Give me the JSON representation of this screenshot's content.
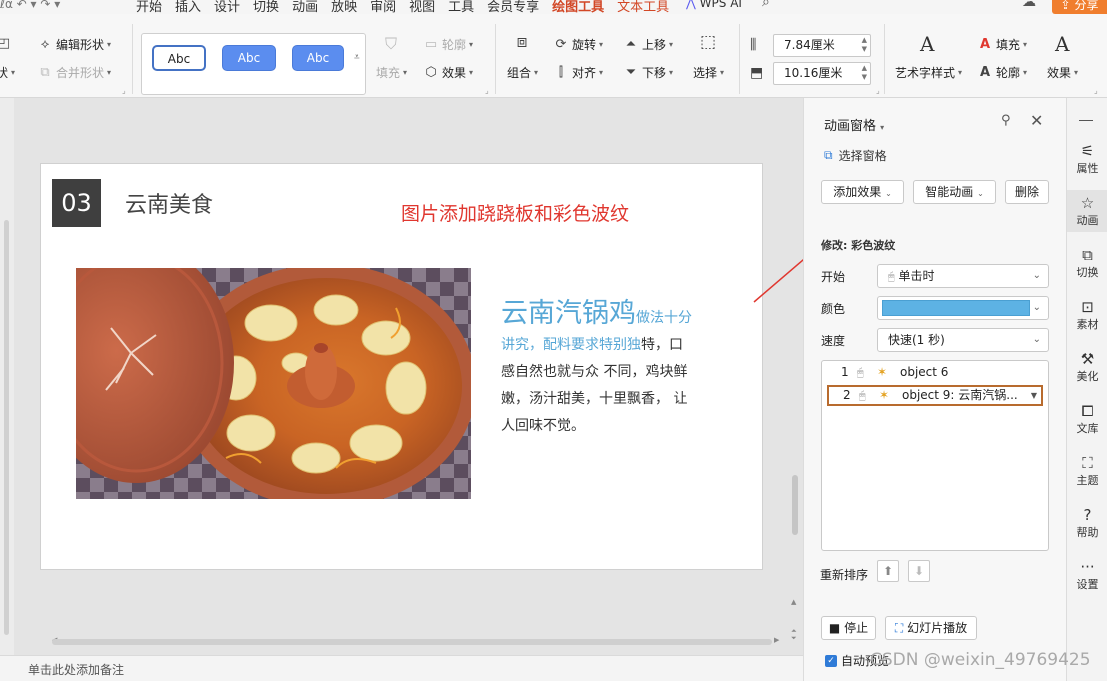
{
  "menu": {
    "quick_access": "ℓα ↶ ▾ ↷ ▾",
    "items": [
      "开始",
      "插入",
      "设计",
      "切换",
      "动画",
      "放映",
      "审阅",
      "视图",
      "工具",
      "会员专享"
    ],
    "active_tab": "绘图工具",
    "text_tab": "文本工具",
    "wps_ai": "WPS AI",
    "share": "分享"
  },
  "ribbon": {
    "edit_shape": "编辑形状",
    "shape": "状",
    "merge_shape": "合并形状",
    "style_gallery": [
      "Abc",
      "Abc",
      "Abc"
    ],
    "fill": "填充",
    "outline": "轮廓",
    "effect": "效果",
    "group": "组合",
    "rotate": "旋转",
    "align": "对齐",
    "move_up": "上移",
    "move_down": "下移",
    "select": "选择",
    "height": "7.84厘米",
    "width": "10.16厘米",
    "art_text_style": "艺术字样式",
    "text_fill": "填充",
    "text_outline": "轮廓",
    "text_effect": "效果"
  },
  "slide": {
    "number": "03",
    "title": "云南美食",
    "annotation": "图片添加跷跷板和彩色波纹",
    "dish": "云南汽锅鸡",
    "desc_blue_1": "做法十分",
    "desc_blue_2": "讲究，配料要求特别独",
    "desc_rest_1": "特，口",
    "desc_rest_2": "感自然也就与众 不同，鸡块鲜",
    "desc_rest_3": "嫩，汤汁甜美，十里飘香， 让",
    "desc_rest_4": "人回味不觉。"
  },
  "notes_placeholder": "单击此处添加备注",
  "pane": {
    "title": "动画窗格",
    "select_pane": "选择窗格",
    "add_effect": "添加效果",
    "smart_anim": "智能动画",
    "delete": "删除",
    "modify": "修改: 彩色波纹",
    "start_label": "开始",
    "start_value": "单击时",
    "color_label": "颜色",
    "color_value": "#5db2e4",
    "speed_label": "速度",
    "speed_value": "快速(1 秒)",
    "items": [
      {
        "num": "1",
        "label": "object 6"
      },
      {
        "num": "2",
        "label": "object 9: 云南汽锅..."
      }
    ],
    "reorder": "重新排序",
    "stop": "停止",
    "slideshow": "幻灯片播放",
    "auto_preview": "自动预览"
  },
  "sidebar": [
    {
      "label": "属性",
      "icon": "properties-icon"
    },
    {
      "label": "动画",
      "icon": "star-icon"
    },
    {
      "label": "切换",
      "icon": "transition-icon"
    },
    {
      "label": "素材",
      "icon": "material-icon"
    },
    {
      "label": "美化",
      "icon": "magic-icon"
    },
    {
      "label": "文库",
      "icon": "library-icon"
    },
    {
      "label": "主题",
      "icon": "theme-icon"
    },
    {
      "label": "帮助",
      "icon": "help-icon"
    },
    {
      "label": "设置",
      "icon": "settings-icon"
    }
  ],
  "watermark": "CSDN @weixin_49769425",
  "colors": {
    "accent": "#d24726",
    "share": "#f07e2e",
    "annotation": "#e0372f",
    "dish": "#57a7d6",
    "selection": "#b86b2e"
  }
}
